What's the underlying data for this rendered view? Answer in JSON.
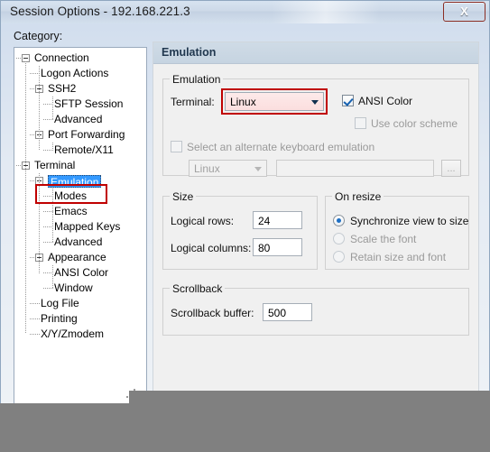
{
  "window": {
    "title": "Session Options - 192.168.221.3",
    "close_label": "X",
    "category_label": "Category:"
  },
  "tree": {
    "items": [
      {
        "label": "Connection",
        "depth": 0,
        "expander": true,
        "selected": false
      },
      {
        "label": "Logon Actions",
        "depth": 1,
        "expander": false,
        "selected": false
      },
      {
        "label": "SSH2",
        "depth": 1,
        "expander": true,
        "selected": false
      },
      {
        "label": "SFTP Session",
        "depth": 2,
        "expander": false,
        "selected": false
      },
      {
        "label": "Advanced",
        "depth": 2,
        "expander": false,
        "selected": false
      },
      {
        "label": "Port Forwarding",
        "depth": 1,
        "expander": true,
        "selected": false
      },
      {
        "label": "Remote/X11",
        "depth": 2,
        "expander": false,
        "selected": false
      },
      {
        "label": "Terminal",
        "depth": 0,
        "expander": true,
        "selected": false
      },
      {
        "label": "Emulation",
        "depth": 1,
        "expander": true,
        "selected": true
      },
      {
        "label": "Modes",
        "depth": 2,
        "expander": false,
        "selected": false
      },
      {
        "label": "Emacs",
        "depth": 2,
        "expander": false,
        "selected": false
      },
      {
        "label": "Mapped Keys",
        "depth": 2,
        "expander": false,
        "selected": false
      },
      {
        "label": "Advanced",
        "depth": 2,
        "expander": false,
        "selected": false
      },
      {
        "label": "Appearance",
        "depth": 1,
        "expander": true,
        "selected": false
      },
      {
        "label": "ANSI Color",
        "depth": 2,
        "expander": false,
        "selected": false
      },
      {
        "label": "Window",
        "depth": 2,
        "expander": false,
        "selected": false
      },
      {
        "label": "Log File",
        "depth": 1,
        "expander": false,
        "selected": false
      },
      {
        "label": "Printing",
        "depth": 1,
        "expander": false,
        "selected": false
      },
      {
        "label": "X/Y/Zmodem",
        "depth": 1,
        "expander": false,
        "selected": false
      }
    ]
  },
  "panel": {
    "header": "Emulation",
    "emulation_group": {
      "title": "Emulation",
      "terminal_label": "Terminal:",
      "terminal_value": "Linux",
      "ansi_color_label": "ANSI Color",
      "ansi_color_checked": "true",
      "use_color_scheme_label": "Use color scheme",
      "use_color_scheme_checked": "false",
      "alt_keyboard_label": "Select an alternate keyboard emulation",
      "alt_keyboard_checked": "false",
      "alt_keyboard_value": "Linux",
      "alt_keyboard_path": "",
      "browse_label": "..."
    },
    "size_group": {
      "title": "Size",
      "rows_label": "Logical rows:",
      "rows_value": "24",
      "cols_label": "Logical columns:",
      "cols_value": "80"
    },
    "resize_group": {
      "title": "On resize",
      "options": [
        {
          "label": "Synchronize view to size",
          "selected": "true"
        },
        {
          "label": "Scale the font",
          "selected": "false"
        },
        {
          "label": "Retain size and font",
          "selected": "false"
        }
      ]
    },
    "scrollback_group": {
      "title": "Scrollback",
      "buffer_label": "Scrollback buffer:",
      "buffer_value": "500"
    }
  },
  "annotations": {
    "highlight_color": "#c00000"
  }
}
